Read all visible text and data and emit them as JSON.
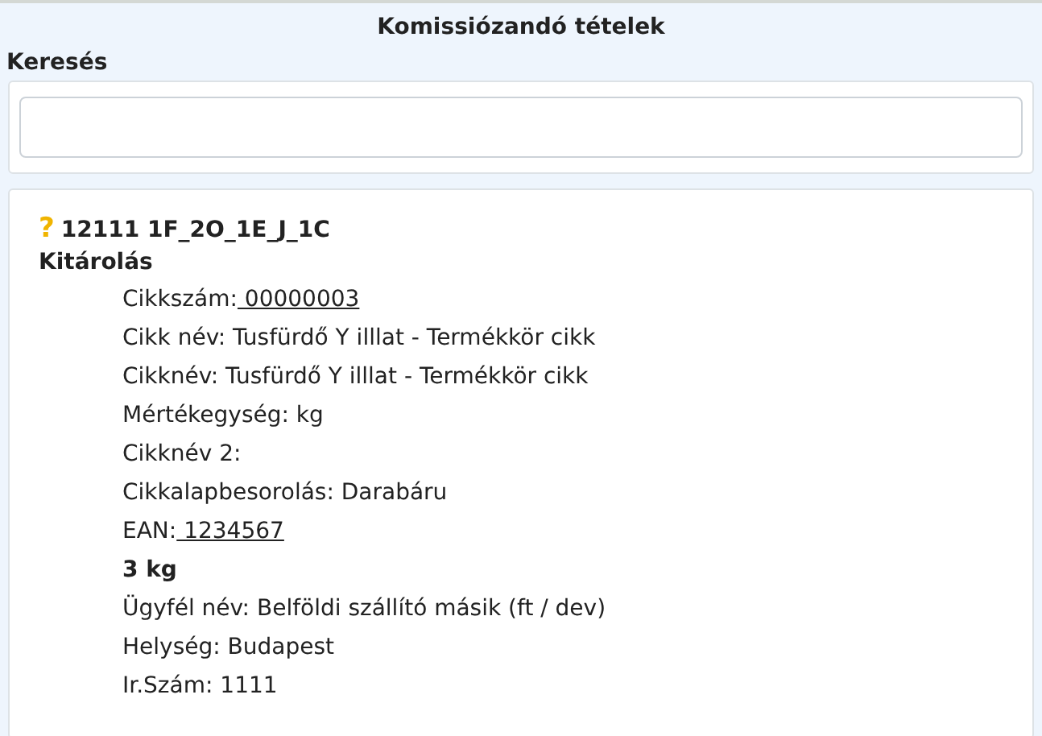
{
  "title": "Komissiózandó tételek",
  "search": {
    "label": "Keresés"
  },
  "item": {
    "status_icon": "?",
    "code": "12111 1F_2O_1E_J_1C",
    "type": "Kitárolás",
    "lines": [
      {
        "kind": "link",
        "label": "Cikkszám:",
        "value": " 00000003"
      },
      {
        "kind": "plain",
        "text": "Cikk név: Tusfürdő Y illlat - Termékkör cikk"
      },
      {
        "kind": "plain",
        "text": "Cikknév: Tusfürdő Y illlat - Termékkör cikk"
      },
      {
        "kind": "plain",
        "text": "Mértékegység: kg"
      },
      {
        "kind": "plain",
        "text": "Cikknév 2:"
      },
      {
        "kind": "plain",
        "text": "Cikkalapbesorolás: Darabáru"
      },
      {
        "kind": "link",
        "label": "EAN:",
        "value": " 1234567"
      },
      {
        "kind": "bold",
        "text": "3 kg"
      },
      {
        "kind": "plain",
        "text": "Ügyfél név: Belföldi szállító másik (ft / dev)"
      },
      {
        "kind": "plain",
        "text": "Helység: Budapest"
      },
      {
        "kind": "plain",
        "text": "Ir.Szám: 1111"
      }
    ]
  }
}
